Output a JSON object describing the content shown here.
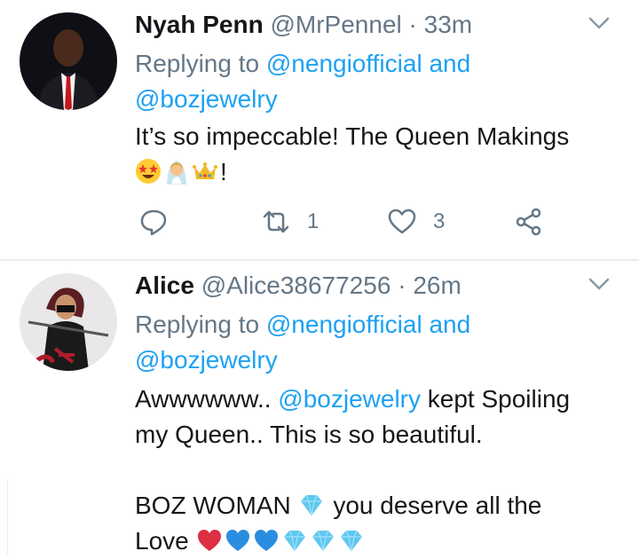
{
  "tweets": [
    {
      "name": "Nyah Penn",
      "handle": "@MrPennel",
      "separator": "·",
      "time": "33m",
      "replying_prefix": "Replying to",
      "reply_mention_1": "@nengiofficial",
      "reply_and": "and",
      "reply_mention_2": "@bozjewelry",
      "body_text": "It’s so impeccable! The Queen Makings",
      "body_emojis": [
        "star-struck-emoji",
        "bride-emoji",
        "crown-emoji"
      ],
      "body_suffix": "!",
      "retweet_count": "1",
      "like_count": "3"
    },
    {
      "name": "Alice",
      "handle": "@Alice38677256",
      "separator": "·",
      "time": "26m",
      "replying_prefix": "Replying to",
      "reply_mention_1": "@nengiofficial",
      "reply_and": "and",
      "reply_mention_2": "@bozjewelry",
      "body_line1_prefix": "Awwwwww..",
      "body_line1_mention": "@bozjewelry",
      "body_line1_suffix": "kept Spoiling",
      "body_line2": "my Queen.. This is so beautiful.",
      "body_line3_prefix": "BOZ WOMAN",
      "body_line3_suffix": "you deserve all the",
      "body_line4": "Love",
      "body_emojis_line4": [
        "red-heart-emoji",
        "blue-heart-emoji",
        "blue-heart-emoji",
        "gem-emoji",
        "gem-emoji",
        "gem-emoji"
      ]
    }
  ],
  "colors": {
    "link": "#1da1f2",
    "muted": "#657786",
    "text": "#14171a"
  }
}
